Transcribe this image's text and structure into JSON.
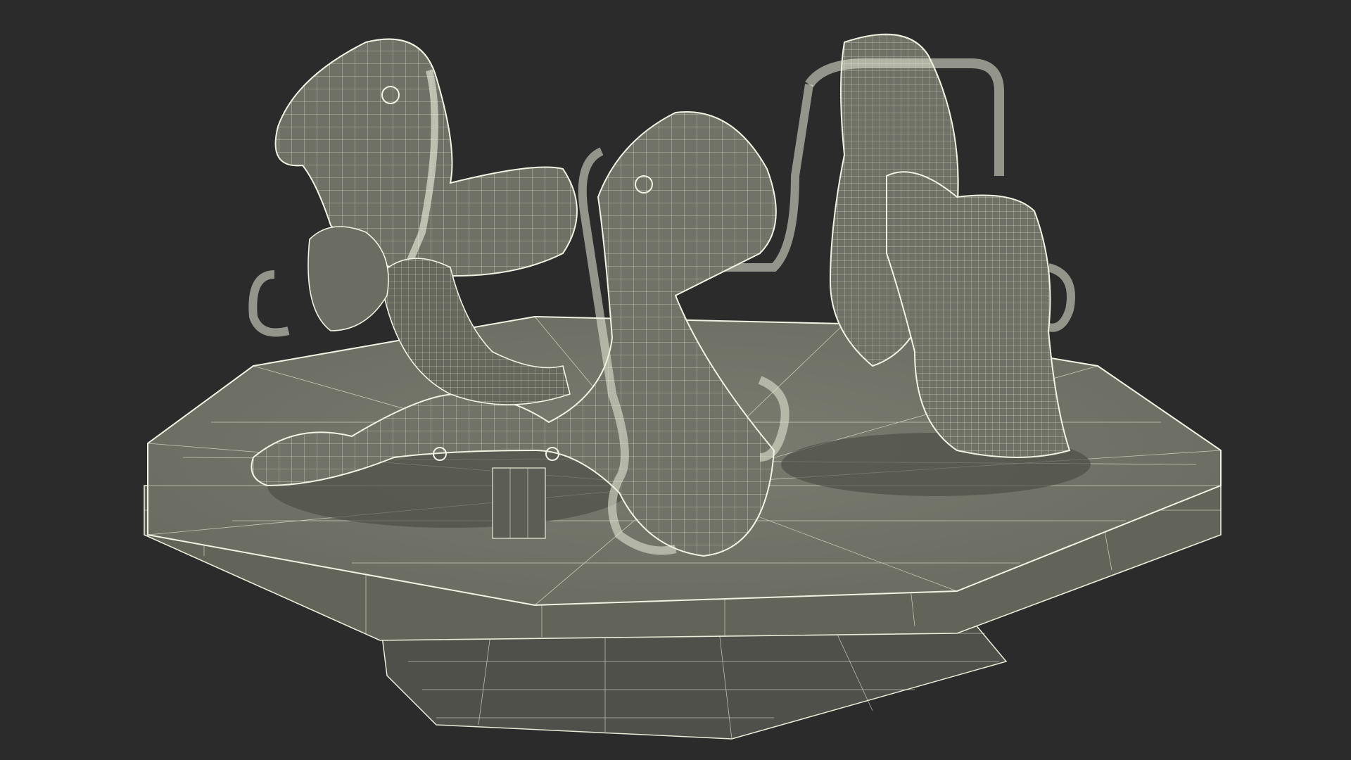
{
  "scene": {
    "subject": "carousel-wireframe-render",
    "background_color": "#2b2b2b",
    "mesh_color": "#6f7166",
    "wire_color": "#e9ecd8"
  }
}
